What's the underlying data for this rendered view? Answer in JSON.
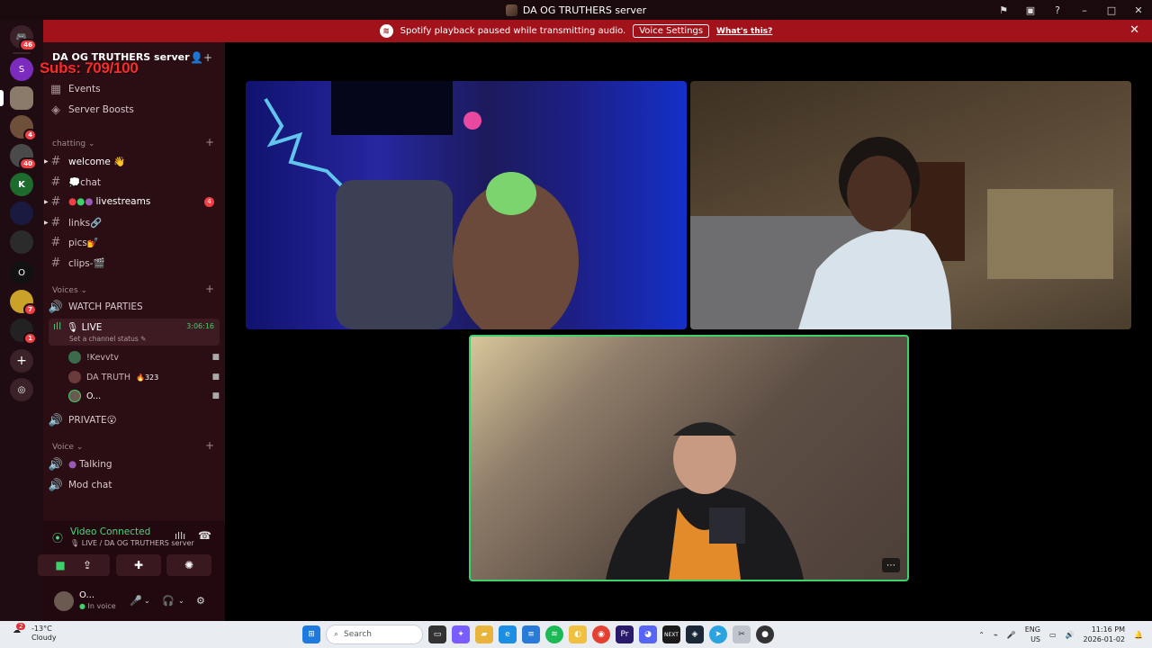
{
  "titlebar": {
    "title": "DA OG TRUTHERS server"
  },
  "notice": {
    "text": "Spotify playback paused while transmitting audio.",
    "button": "Voice Settings",
    "link": "What's this?"
  },
  "guilds": {
    "badges": [
      "46",
      "4",
      "40",
      "7",
      "1"
    ]
  },
  "server": {
    "name": "DA OG TRUTHERS server",
    "overlay": "Subs: 709/100"
  },
  "top_items": [
    "Events",
    "Server Boosts"
  ],
  "categories": {
    "chatting": "chatting",
    "voices": "Voices",
    "voice": "Voice"
  },
  "text_channels": [
    {
      "name": "welcome 👋"
    },
    {
      "name": "💭chat"
    },
    {
      "name": "livestreams",
      "unread": "4"
    },
    {
      "name": "links🔗"
    },
    {
      "name": "pics💅"
    },
    {
      "name": "clips-🎬"
    }
  ],
  "voice_channels": {
    "watch": "WATCH PARTIES",
    "live": "LIVE",
    "live_timer": "3:06:16",
    "live_status": "Set a channel status",
    "users": [
      {
        "name": "!Kevvtv"
      },
      {
        "name": "DA TRUTH",
        "badge": "323"
      },
      {
        "name": "O..."
      }
    ],
    "private": "PRIVATE😮",
    "talking": "Talking",
    "mod": "Mod chat"
  },
  "voice_panel": {
    "title": "Video Connected",
    "sub": "LIVE / DA OG TRUTHERS server"
  },
  "user": {
    "name": "O...",
    "status": "In voice"
  },
  "taskbar": {
    "temp": "-13°C",
    "cond": "Cloudy",
    "weather_badge": "2",
    "search": "Search",
    "lang1": "ENG",
    "lang2": "US",
    "time": "11:16 PM",
    "date": "2026-01-02"
  },
  "colors": {
    "accent_red": "#a1121b",
    "speaking_green": "#3dd16a",
    "sidebar_bg": "#2a0e14"
  }
}
